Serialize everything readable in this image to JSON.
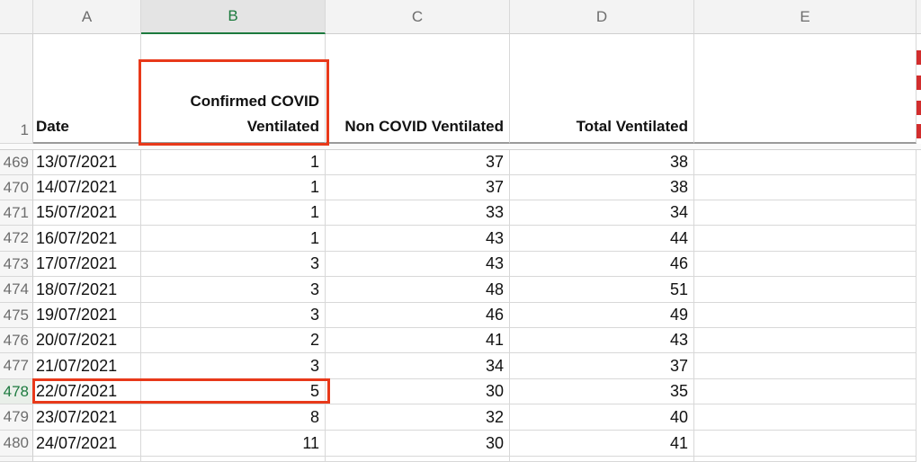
{
  "columns": [
    "A",
    "B",
    "C",
    "D",
    "E"
  ],
  "active_column": "B",
  "header_row": {
    "row_number": "1",
    "date": "Date",
    "confirmed_line1": "Confirmed COVID",
    "confirmed_line2": "Ventilated",
    "non_covid": "Non COVID Ventilated",
    "total": "Total Ventilated"
  },
  "rows": [
    {
      "num": "469",
      "date": "13/07/2021",
      "confirmed": "1",
      "non_covid": "37",
      "total": "38"
    },
    {
      "num": "470",
      "date": "14/07/2021",
      "confirmed": "1",
      "non_covid": "37",
      "total": "38"
    },
    {
      "num": "471",
      "date": "15/07/2021",
      "confirmed": "1",
      "non_covid": "33",
      "total": "34"
    },
    {
      "num": "472",
      "date": "16/07/2021",
      "confirmed": "1",
      "non_covid": "43",
      "total": "44"
    },
    {
      "num": "473",
      "date": "17/07/2021",
      "confirmed": "3",
      "non_covid": "43",
      "total": "46"
    },
    {
      "num": "474",
      "date": "18/07/2021",
      "confirmed": "3",
      "non_covid": "48",
      "total": "51"
    },
    {
      "num": "475",
      "date": "19/07/2021",
      "confirmed": "3",
      "non_covid": "46",
      "total": "49"
    },
    {
      "num": "476",
      "date": "20/07/2021",
      "confirmed": "2",
      "non_covid": "41",
      "total": "43"
    },
    {
      "num": "477",
      "date": "21/07/2021",
      "confirmed": "3",
      "non_covid": "34",
      "total": "37"
    },
    {
      "num": "478",
      "date": "22/07/2021",
      "confirmed": "5",
      "non_covid": "30",
      "total": "35"
    },
    {
      "num": "479",
      "date": "23/07/2021",
      "confirmed": "8",
      "non_covid": "32",
      "total": "40"
    },
    {
      "num": "480",
      "date": "24/07/2021",
      "confirmed": "11",
      "non_covid": "30",
      "total": "41"
    }
  ],
  "active_row": "478",
  "colors": {
    "highlight_border": "#e8391a",
    "active_header_text": "#1c7a3e"
  }
}
